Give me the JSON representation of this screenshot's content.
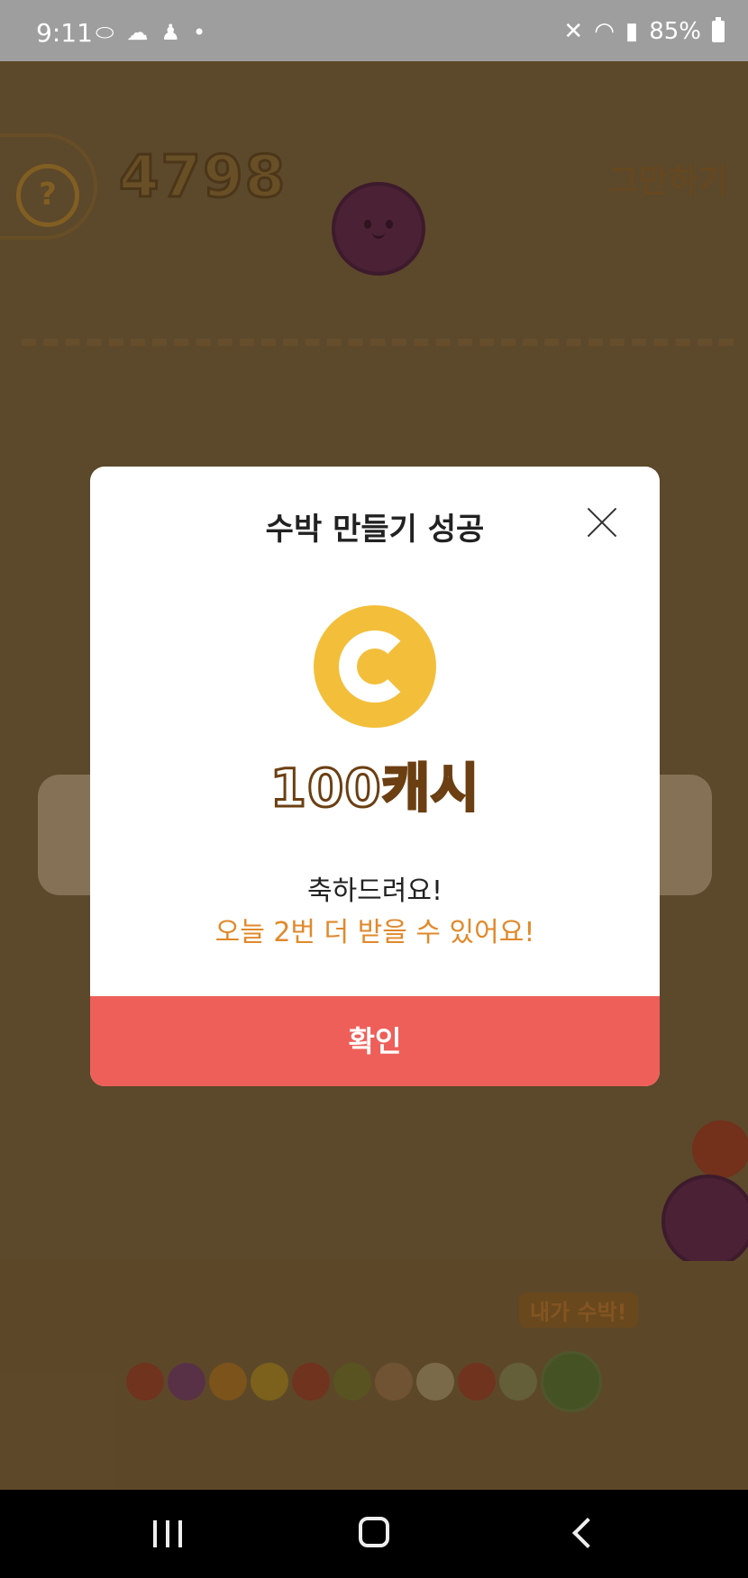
{
  "status_bar": {
    "time": "9:11",
    "battery": "85%"
  },
  "game": {
    "score": "4798",
    "help_label": "?",
    "stop_label": "그만하기",
    "watermelon_tag": "내가 수박!"
  },
  "modal": {
    "title": "수박 만들기 성공",
    "reward": "100캐시",
    "message": "축하드려요!",
    "sub_message": "오늘 2번 더 받을 수 있어요!",
    "confirm_label": "확인"
  },
  "colors": {
    "confirm_button": "#ee5f5a",
    "coin": "#f3bf3a",
    "accent_text": "#e0892b"
  }
}
